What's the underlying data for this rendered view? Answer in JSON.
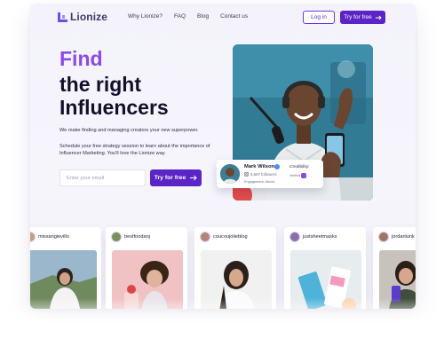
{
  "nav": {
    "logo_text": "Lionize",
    "links": [
      "Why Lionize?",
      "FAQ",
      "Blog",
      "Contact us"
    ],
    "login_label": "Log in",
    "try_label": "Try for free"
  },
  "hero": {
    "title_line1": "Find",
    "title_line2": "the right",
    "title_line3": "Influencers",
    "subtitle": "We make finding and managing creators your new superpower.",
    "body": "Schedule your free strategy session to learn about the importance of Influencer Marketing. You'll love the Lionize way.",
    "email_placeholder": "Enter your email",
    "cta_label": "Try for free"
  },
  "influencer_card": {
    "name": "Mark Wilson",
    "followers": "6,587 followers",
    "engagement": "Engagement: Above",
    "credibility_label": "Credibility:",
    "verified_label": "Verified"
  },
  "creators": [
    {
      "handle": "missangievillo"
    },
    {
      "handle": "bestfoodanj"
    },
    {
      "handle": "coucoujolieblog"
    },
    {
      "handle": "justsheetmasks"
    },
    {
      "handle": "jordanlunk"
    }
  ],
  "colors": {
    "accent": "#5b24c6",
    "title_accent": "#8c49ea"
  }
}
